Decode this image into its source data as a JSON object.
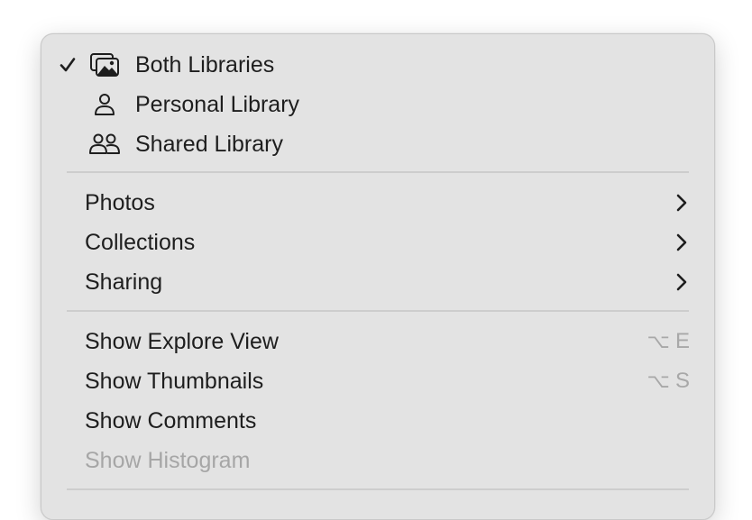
{
  "library_filter": {
    "items": [
      {
        "label": "Both Libraries",
        "checked": true,
        "icon": "photo-stack-icon"
      },
      {
        "label": "Personal Library",
        "checked": false,
        "icon": "person-icon"
      },
      {
        "label": "Shared Library",
        "checked": false,
        "icon": "people-icon"
      }
    ]
  },
  "submenus": {
    "items": [
      {
        "label": "Photos",
        "icon": "chevron-right-icon"
      },
      {
        "label": "Collections",
        "icon": "chevron-right-icon"
      },
      {
        "label": "Sharing",
        "icon": "chevron-right-icon"
      }
    ]
  },
  "view_options": {
    "items": [
      {
        "label": "Show Explore View",
        "shortcut_modifier": "⌥",
        "shortcut_key": "E",
        "enabled": true
      },
      {
        "label": "Show Thumbnails",
        "shortcut_modifier": "⌥",
        "shortcut_key": "S",
        "enabled": true
      },
      {
        "label": "Show Comments",
        "enabled": true
      },
      {
        "label": "Show Histogram",
        "enabled": false
      }
    ]
  },
  "colors": {
    "menu_background": "#e3e3e3",
    "text": "#1e1e1e",
    "disabled_text": "#a6a6a6",
    "separator": "#cdcdcd"
  }
}
